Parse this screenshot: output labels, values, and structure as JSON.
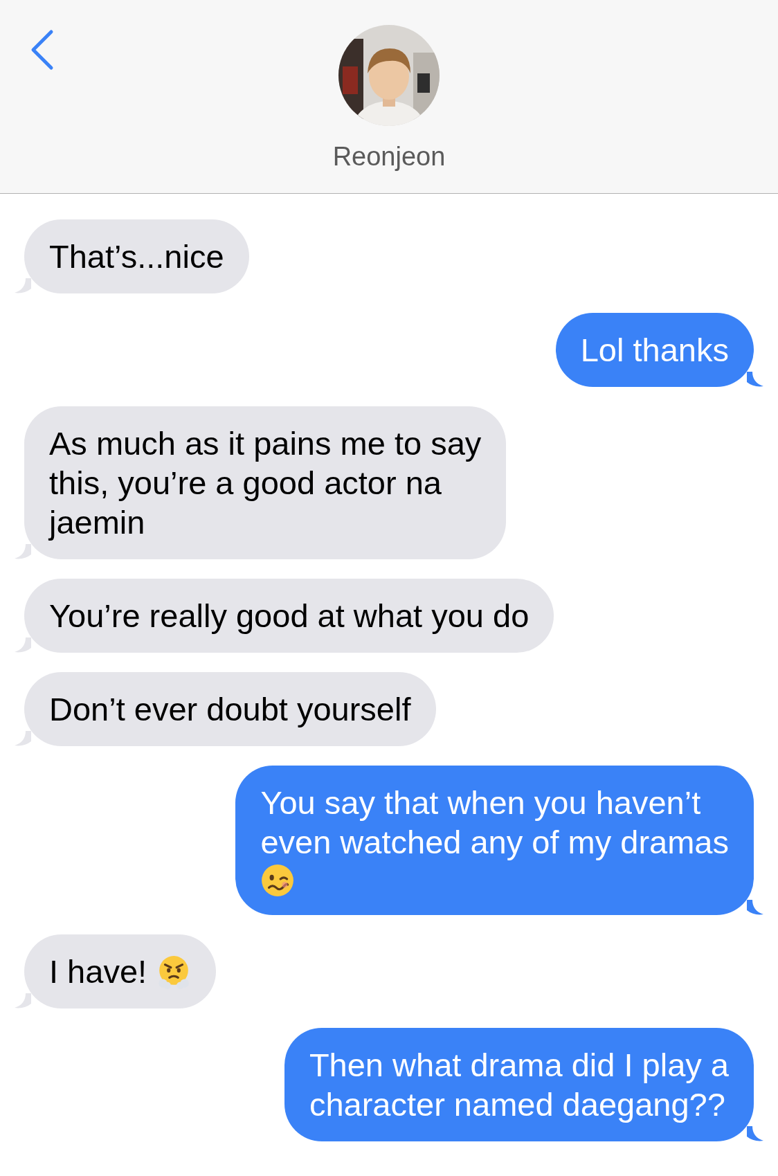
{
  "header": {
    "contact_name": "Reonjeon"
  },
  "messages": [
    {
      "kind": "incoming",
      "text": "That’s...nice"
    },
    {
      "kind": "outgoing",
      "text": "Lol thanks"
    },
    {
      "kind": "incoming",
      "text": "As much as it pains me to say\nthis, you’re a good actor na\njaemin"
    },
    {
      "kind": "incoming",
      "text": "You’re really good at what you do"
    },
    {
      "kind": "incoming",
      "text": "Don’t ever doubt yourself"
    },
    {
      "kind": "outgoing",
      "text": "You say that when you haven’t\neven watched any of my dramas",
      "emoji": {
        "kind": "woozy",
        "own_line": true
      }
    },
    {
      "kind": "incoming",
      "text": "I have!",
      "emoji": {
        "kind": "huffing",
        "own_line": false
      }
    },
    {
      "kind": "outgoing",
      "text": "Then what drama did I play a\ncharacter named daegang??"
    }
  ]
}
